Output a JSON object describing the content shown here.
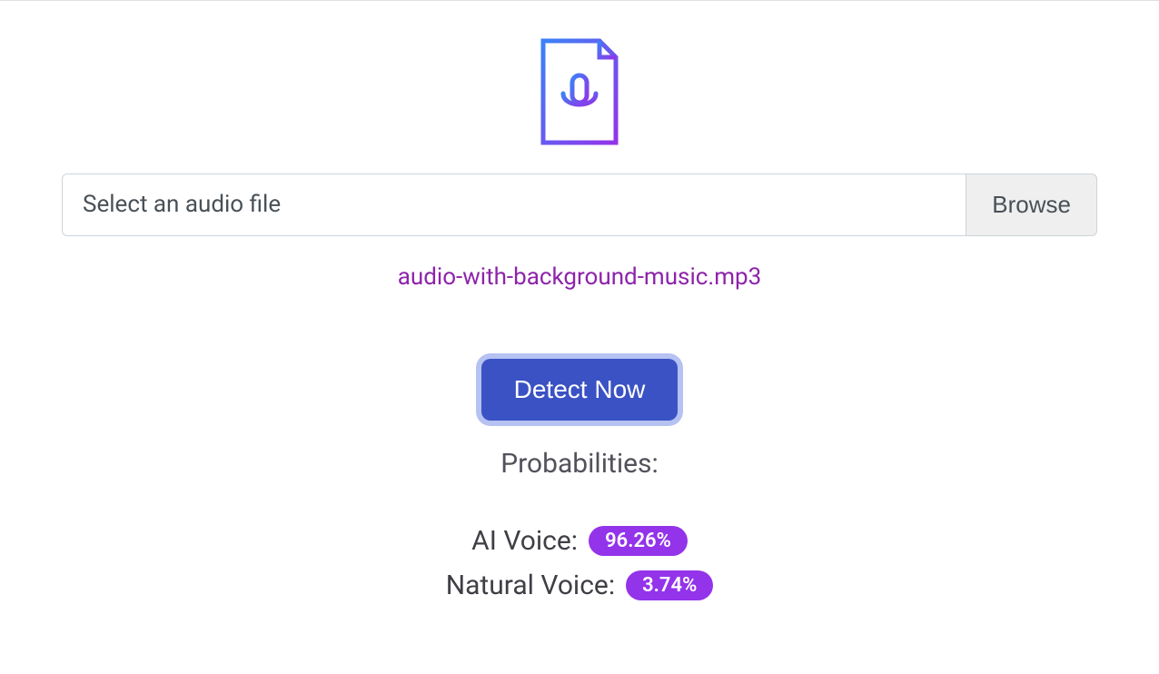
{
  "file_input": {
    "placeholder": "Select an audio file",
    "browse_label": "Browse",
    "selected_filename": "audio-with-background-music.mp3"
  },
  "detect_button_label": "Detect Now",
  "results": {
    "heading": "Probabilities:",
    "ai_voice": {
      "label": "AI Voice:",
      "value": "96.26%"
    },
    "natural_voice": {
      "label": "Natural Voice:",
      "value": "3.74%"
    }
  },
  "icon": {
    "name": "audio-file-mic-icon"
  }
}
